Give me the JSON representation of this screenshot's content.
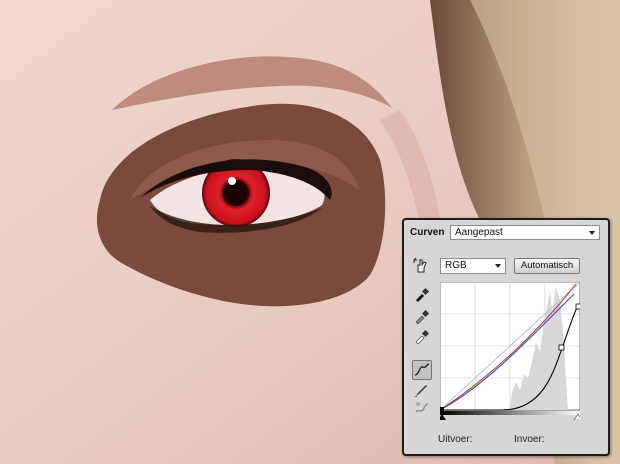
{
  "panel": {
    "title": "Curven",
    "preset": "Aangepast",
    "channel": "RGB",
    "auto_button": "Automatisch",
    "output_label": "Uitvoer:",
    "input_label": "Invoer:"
  },
  "tools": [
    {
      "icon": "hand-adjust-icon"
    },
    {
      "icon": "black-point-eyedropper-icon"
    },
    {
      "icon": "gray-point-eyedropper-icon"
    },
    {
      "icon": "white-point-eyedropper-icon"
    },
    {
      "icon": "curve-point-icon"
    },
    {
      "icon": "pencil-icon"
    },
    {
      "icon": "smooth-icon"
    }
  ],
  "colors": {
    "panel_bg": "#d6d6d6",
    "curve_rgb": "#000000",
    "curve_red": "#d23b2e",
    "curve_blue": "#2c4fd0",
    "eye_shadow": "#7a4a3a",
    "iris": "#e0202a"
  }
}
